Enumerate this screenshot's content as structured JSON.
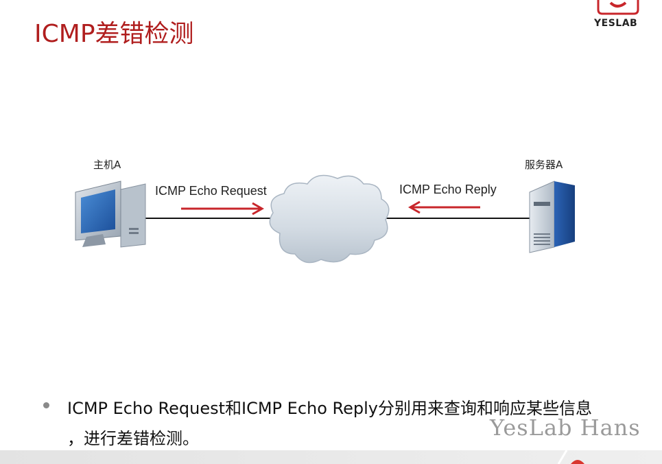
{
  "slide": {
    "title": "ICMP差错检测",
    "logo_text": "YESLAB"
  },
  "diagram": {
    "nodes": {
      "host_label": "主机A",
      "server_label": "服务器A"
    },
    "arrows": {
      "request_label": "ICMP Echo Request",
      "reply_label": "ICMP Echo Reply"
    },
    "colors": {
      "arrow": "#c8262b",
      "line": "#111111",
      "cloud": "#c9d3dd"
    }
  },
  "content": {
    "bullet_line1": "ICMP Echo Request和ICMP Echo Reply分别用来查询和响应某些信息",
    "bullet_line2": "，进行差错检测。",
    "watermark": "YesLab Hans"
  }
}
